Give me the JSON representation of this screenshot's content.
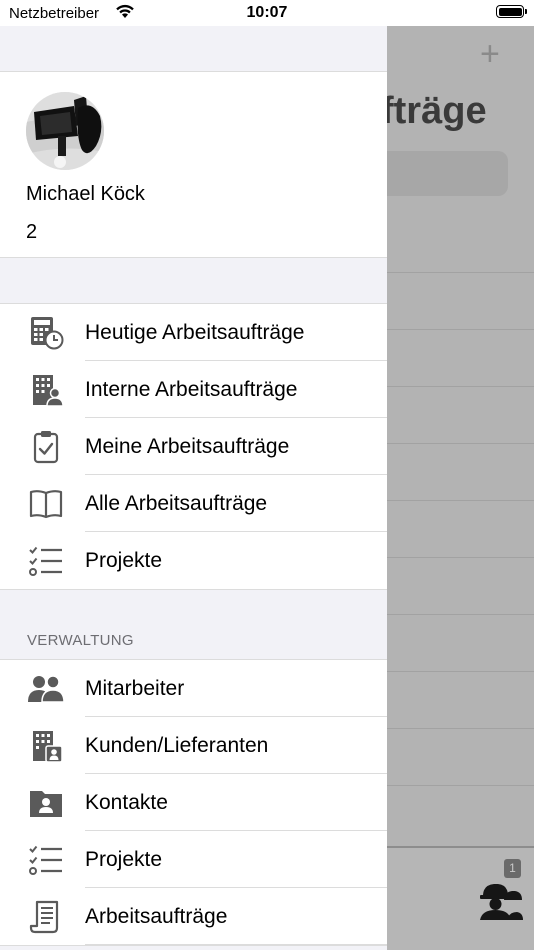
{
  "status_bar": {
    "carrier": "Netzbetreiber",
    "time": "10:07"
  },
  "background": {
    "title_fragment": "fträge",
    "tab_badge": "1",
    "icons": {
      "add": "plus-icon",
      "tab": "worker-helmet-icon"
    }
  },
  "drawer": {
    "profile": {
      "name": "Michael Köck",
      "subtitle": "2"
    },
    "main_items": [
      {
        "label": "Heutige Arbeitsaufträge",
        "icon": "calculator-clock-icon"
      },
      {
        "label": "Interne Arbeitsaufträge",
        "icon": "building-person-icon"
      },
      {
        "label": "Meine Arbeitsaufträge",
        "icon": "clipboard-check-icon"
      },
      {
        "label": "Alle Arbeitsaufträge",
        "icon": "open-book-icon"
      },
      {
        "label": "Projekte",
        "icon": "checklist-icon"
      }
    ],
    "admin_section": {
      "header": "VERWALTUNG",
      "items": [
        {
          "label": "Mitarbeiter",
          "icon": "people-icon"
        },
        {
          "label": "Kunden/Lieferanten",
          "icon": "building-contact-icon"
        },
        {
          "label": "Kontakte",
          "icon": "contact-folder-icon"
        },
        {
          "label": "Projekte",
          "icon": "checklist-icon"
        },
        {
          "label": "Arbeitsaufträge",
          "icon": "document-list-icon"
        }
      ]
    }
  },
  "colors": {
    "icon": "#5a5a5a",
    "overlay": "#b3b3b3",
    "section_header": "#6d6d72"
  }
}
